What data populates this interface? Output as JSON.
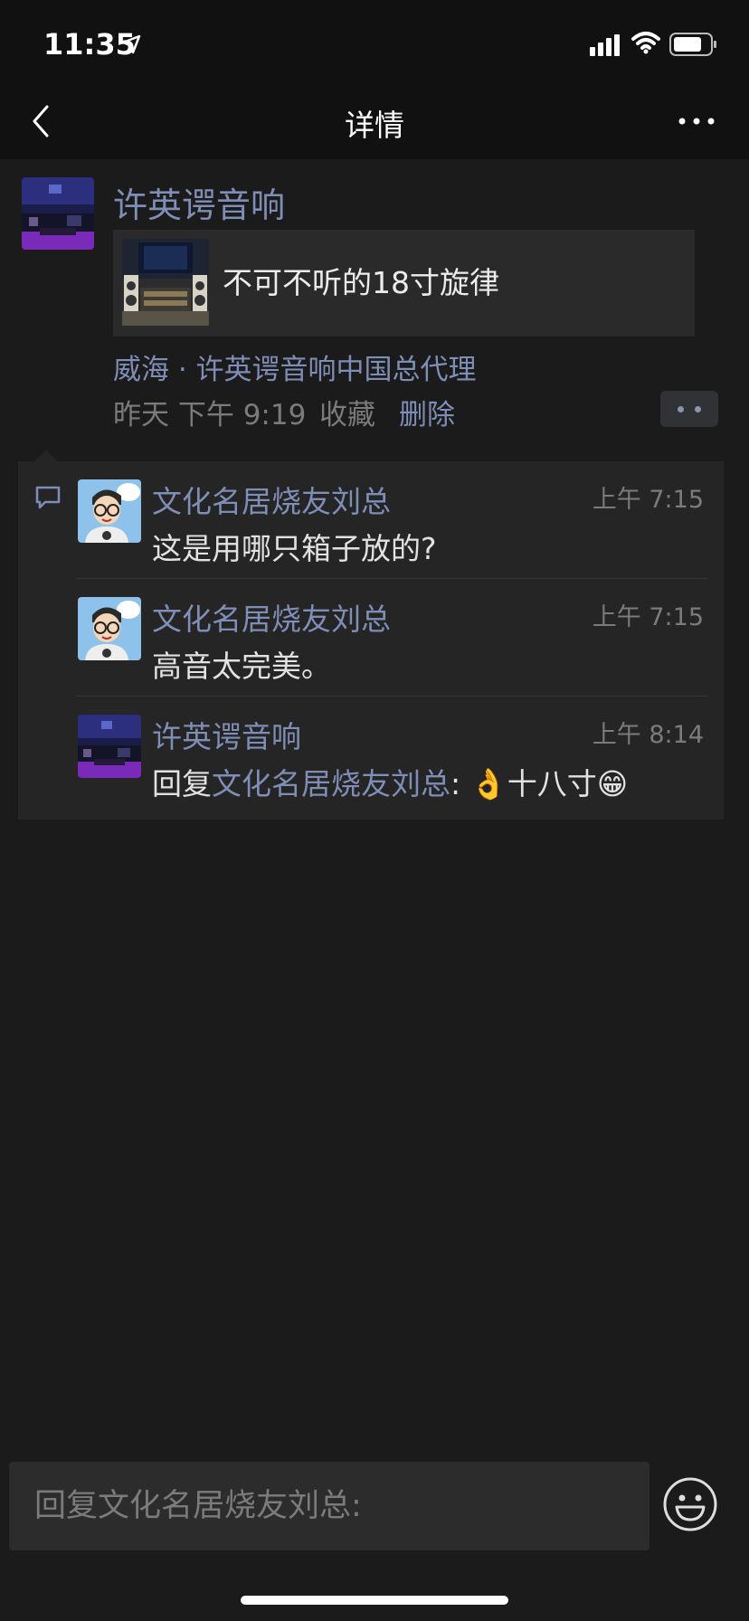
{
  "status_bar": {
    "time": "11:35"
  },
  "nav": {
    "title": "详情",
    "back_icon": "chevron-left-icon",
    "more_icon": "more-dots-icon"
  },
  "post": {
    "author": "许英谔音响",
    "share_title": "不可不听的18寸旋律",
    "location": "威海 · 许英谔音响中国总代理",
    "time": "昨天 下午 9:19",
    "favorite_label": "收藏",
    "delete_label": "删除"
  },
  "comments": [
    {
      "author": "文化名居烧友刘总",
      "time": "上午 7:15",
      "text": "这是用哪只箱子放的?"
    },
    {
      "author": "文化名居烧友刘总",
      "time": "上午 7:15",
      "text": "高音太完美。"
    },
    {
      "author": "许英谔音响",
      "time": "上午 8:14",
      "reply_prefix": "回复",
      "reply_to": "文化名居烧友刘总",
      "text": ": 👌十八寸😁"
    }
  ],
  "input": {
    "placeholder": "回复文化名居烧友刘总:"
  },
  "colors": {
    "link": "#7f8eb6",
    "background": "#1b1b1b",
    "bar": "#111111",
    "comment_bg": "#252525"
  }
}
